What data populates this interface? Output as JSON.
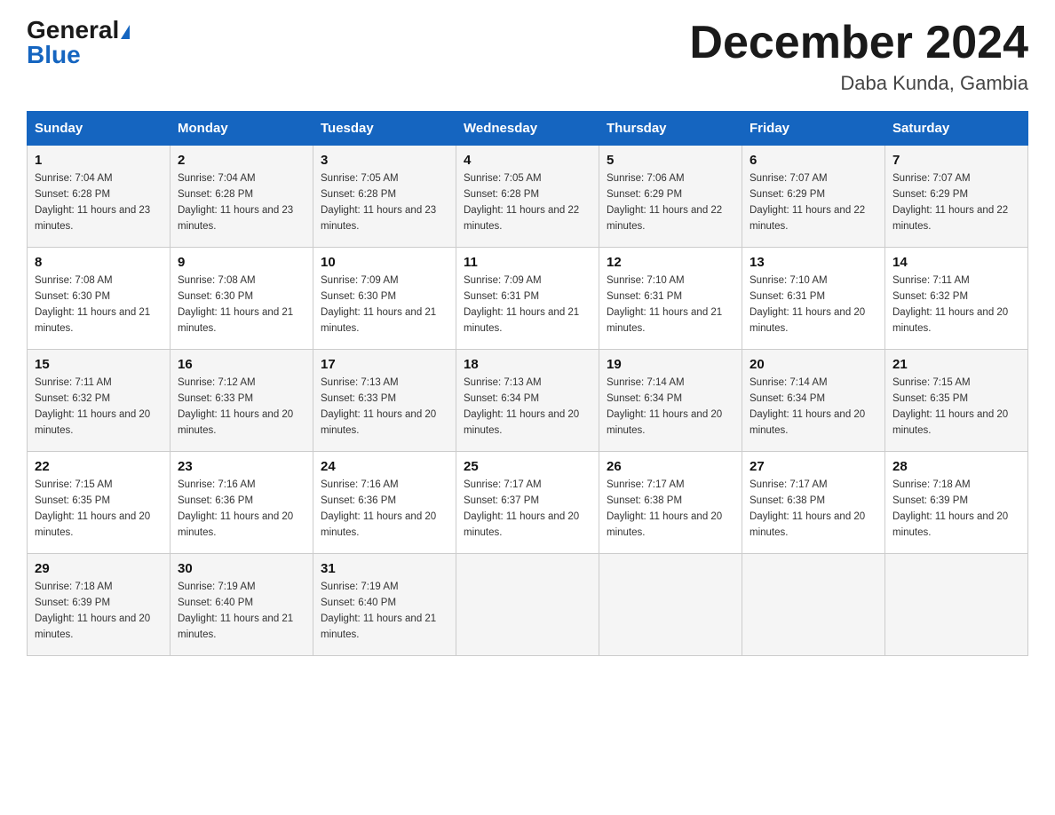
{
  "logo": {
    "general": "General",
    "triangle": "▲",
    "blue": "Blue"
  },
  "title": {
    "month": "December 2024",
    "location": "Daba Kunda, Gambia"
  },
  "days_of_week": [
    "Sunday",
    "Monday",
    "Tuesday",
    "Wednesday",
    "Thursday",
    "Friday",
    "Saturday"
  ],
  "weeks": [
    [
      {
        "day": "1",
        "sunrise": "7:04 AM",
        "sunset": "6:28 PM",
        "daylight": "11 hours and 23 minutes."
      },
      {
        "day": "2",
        "sunrise": "7:04 AM",
        "sunset": "6:28 PM",
        "daylight": "11 hours and 23 minutes."
      },
      {
        "day": "3",
        "sunrise": "7:05 AM",
        "sunset": "6:28 PM",
        "daylight": "11 hours and 23 minutes."
      },
      {
        "day": "4",
        "sunrise": "7:05 AM",
        "sunset": "6:28 PM",
        "daylight": "11 hours and 22 minutes."
      },
      {
        "day": "5",
        "sunrise": "7:06 AM",
        "sunset": "6:29 PM",
        "daylight": "11 hours and 22 minutes."
      },
      {
        "day": "6",
        "sunrise": "7:07 AM",
        "sunset": "6:29 PM",
        "daylight": "11 hours and 22 minutes."
      },
      {
        "day": "7",
        "sunrise": "7:07 AM",
        "sunset": "6:29 PM",
        "daylight": "11 hours and 22 minutes."
      }
    ],
    [
      {
        "day": "8",
        "sunrise": "7:08 AM",
        "sunset": "6:30 PM",
        "daylight": "11 hours and 21 minutes."
      },
      {
        "day": "9",
        "sunrise": "7:08 AM",
        "sunset": "6:30 PM",
        "daylight": "11 hours and 21 minutes."
      },
      {
        "day": "10",
        "sunrise": "7:09 AM",
        "sunset": "6:30 PM",
        "daylight": "11 hours and 21 minutes."
      },
      {
        "day": "11",
        "sunrise": "7:09 AM",
        "sunset": "6:31 PM",
        "daylight": "11 hours and 21 minutes."
      },
      {
        "day": "12",
        "sunrise": "7:10 AM",
        "sunset": "6:31 PM",
        "daylight": "11 hours and 21 minutes."
      },
      {
        "day": "13",
        "sunrise": "7:10 AM",
        "sunset": "6:31 PM",
        "daylight": "11 hours and 20 minutes."
      },
      {
        "day": "14",
        "sunrise": "7:11 AM",
        "sunset": "6:32 PM",
        "daylight": "11 hours and 20 minutes."
      }
    ],
    [
      {
        "day": "15",
        "sunrise": "7:11 AM",
        "sunset": "6:32 PM",
        "daylight": "11 hours and 20 minutes."
      },
      {
        "day": "16",
        "sunrise": "7:12 AM",
        "sunset": "6:33 PM",
        "daylight": "11 hours and 20 minutes."
      },
      {
        "day": "17",
        "sunrise": "7:13 AM",
        "sunset": "6:33 PM",
        "daylight": "11 hours and 20 minutes."
      },
      {
        "day": "18",
        "sunrise": "7:13 AM",
        "sunset": "6:34 PM",
        "daylight": "11 hours and 20 minutes."
      },
      {
        "day": "19",
        "sunrise": "7:14 AM",
        "sunset": "6:34 PM",
        "daylight": "11 hours and 20 minutes."
      },
      {
        "day": "20",
        "sunrise": "7:14 AM",
        "sunset": "6:34 PM",
        "daylight": "11 hours and 20 minutes."
      },
      {
        "day": "21",
        "sunrise": "7:15 AM",
        "sunset": "6:35 PM",
        "daylight": "11 hours and 20 minutes."
      }
    ],
    [
      {
        "day": "22",
        "sunrise": "7:15 AM",
        "sunset": "6:35 PM",
        "daylight": "11 hours and 20 minutes."
      },
      {
        "day": "23",
        "sunrise": "7:16 AM",
        "sunset": "6:36 PM",
        "daylight": "11 hours and 20 minutes."
      },
      {
        "day": "24",
        "sunrise": "7:16 AM",
        "sunset": "6:36 PM",
        "daylight": "11 hours and 20 minutes."
      },
      {
        "day": "25",
        "sunrise": "7:17 AM",
        "sunset": "6:37 PM",
        "daylight": "11 hours and 20 minutes."
      },
      {
        "day": "26",
        "sunrise": "7:17 AM",
        "sunset": "6:38 PM",
        "daylight": "11 hours and 20 minutes."
      },
      {
        "day": "27",
        "sunrise": "7:17 AM",
        "sunset": "6:38 PM",
        "daylight": "11 hours and 20 minutes."
      },
      {
        "day": "28",
        "sunrise": "7:18 AM",
        "sunset": "6:39 PM",
        "daylight": "11 hours and 20 minutes."
      }
    ],
    [
      {
        "day": "29",
        "sunrise": "7:18 AM",
        "sunset": "6:39 PM",
        "daylight": "11 hours and 20 minutes."
      },
      {
        "day": "30",
        "sunrise": "7:19 AM",
        "sunset": "6:40 PM",
        "daylight": "11 hours and 21 minutes."
      },
      {
        "day": "31",
        "sunrise": "7:19 AM",
        "sunset": "6:40 PM",
        "daylight": "11 hours and 21 minutes."
      },
      null,
      null,
      null,
      null
    ]
  ],
  "labels": {
    "sunrise": "Sunrise:",
    "sunset": "Sunset:",
    "daylight": "Daylight:"
  }
}
